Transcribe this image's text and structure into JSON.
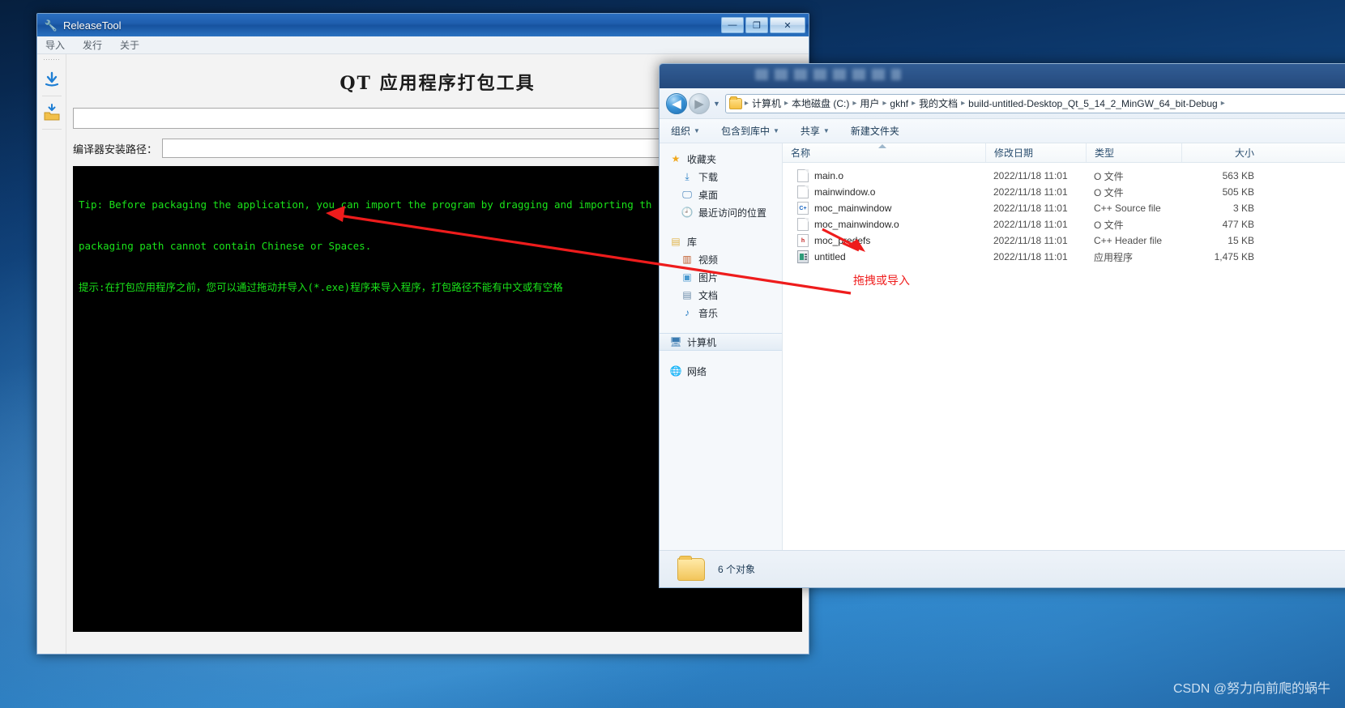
{
  "release_tool": {
    "title": "ReleaseTool",
    "title_icon": "tools-icon",
    "window_buttons": {
      "minimize": "—",
      "maximize": "❐",
      "close": "✕"
    },
    "menu": [
      {
        "label": "导入",
        "name": "menu-import"
      },
      {
        "label": "发行",
        "name": "menu-publish"
      },
      {
        "label": "关于",
        "name": "menu-about"
      }
    ],
    "toolbar": [
      {
        "name": "import-file-icon",
        "glyph": "⬇"
      },
      {
        "name": "import-folder-icon",
        "glyph": "📁"
      }
    ],
    "heading": "QT 应用程序打包工具",
    "path_input_value": "",
    "path_input_placeholder": "",
    "compiler_label": "编译器安装路径：",
    "compiler_input_value": "",
    "compiler_input_placeholder": "",
    "console_lines": [
      "Tip: Before packaging the application, you can import the program by dragging and importing th",
      "packaging path cannot contain Chinese or Spaces.",
      "提示:在打包应用程序之前，您可以通过拖动并导入(*.exe)程序来导入程序，打包路径不能有中文或有空格"
    ],
    "console_color": "#1ae31a",
    "console_background": "#000000"
  },
  "explorer": {
    "nav": {
      "back": "◀",
      "forward": "▶",
      "recent": "▼"
    },
    "breadcrumbs": [
      "计算机",
      "本地磁盘 (C:)",
      "用户",
      "gkhf",
      "我的文档",
      "build-untitled-Desktop_Qt_5_14_2_MinGW_64_bit-Debug"
    ],
    "breadcrumb_separator": "▸",
    "toolbar": [
      {
        "label": "组织",
        "name": "toolbar-organize",
        "caret": "▼"
      },
      {
        "label": "包含到库中",
        "name": "toolbar-include-in-library",
        "caret": "▼"
      },
      {
        "label": "共享",
        "name": "toolbar-share",
        "caret": "▼"
      },
      {
        "label": "新建文件夹",
        "name": "toolbar-new-folder",
        "caret": ""
      }
    ],
    "sidebar": [
      {
        "label": "收藏夹",
        "icon": "star-icon",
        "glyph": "★",
        "level": 0,
        "selected": false
      },
      {
        "label": "下载",
        "icon": "downloads-icon",
        "glyph": "⤓",
        "level": 1,
        "selected": false
      },
      {
        "label": "桌面",
        "icon": "desktop-icon",
        "glyph": "🖵",
        "level": 1,
        "selected": false
      },
      {
        "label": "最近访问的位置",
        "icon": "recent-places-icon",
        "glyph": "🕘",
        "level": 1,
        "selected": false
      },
      {
        "label": "库",
        "icon": "libraries-icon",
        "glyph": "▤",
        "level": 0,
        "selected": false
      },
      {
        "label": "视频",
        "icon": "videos-icon",
        "glyph": "▥",
        "level": 1,
        "selected": false
      },
      {
        "label": "图片",
        "icon": "pictures-icon",
        "glyph": "▣",
        "level": 1,
        "selected": false
      },
      {
        "label": "文档",
        "icon": "documents-icon",
        "glyph": "▤",
        "level": 1,
        "selected": false
      },
      {
        "label": "音乐",
        "icon": "music-icon",
        "glyph": "♪",
        "level": 1,
        "selected": false
      },
      {
        "label": "计算机",
        "icon": "computer-icon",
        "glyph": "🖥",
        "level": 0,
        "selected": true
      },
      {
        "label": "网络",
        "icon": "network-icon",
        "glyph": "🌐",
        "level": 0,
        "selected": false
      }
    ],
    "columns": [
      "名称",
      "修改日期",
      "类型",
      "大小"
    ],
    "files": [
      {
        "name": "main.o",
        "date": "2022/11/18 11:01",
        "type": "O 文件",
        "size": "563 KB",
        "icon": "o-file-icon"
      },
      {
        "name": "mainwindow.o",
        "date": "2022/11/18 11:01",
        "type": "O 文件",
        "size": "505 KB",
        "icon": "o-file-icon"
      },
      {
        "name": "moc_mainwindow",
        "date": "2022/11/18 11:01",
        "type": "C++ Source file",
        "size": "3 KB",
        "icon": "cpp-source-icon"
      },
      {
        "name": "moc_mainwindow.o",
        "date": "2022/11/18 11:01",
        "type": "O 文件",
        "size": "477 KB",
        "icon": "o-file-icon"
      },
      {
        "name": "moc_predefs",
        "date": "2022/11/18 11:01",
        "type": "C++ Header file",
        "size": "15 KB",
        "icon": "cpp-header-icon"
      },
      {
        "name": "untitled",
        "date": "2022/11/18 11:01",
        "type": "应用程序",
        "size": "1,475 KB",
        "icon": "application-icon"
      }
    ],
    "status_text": "6 个对象"
  },
  "annotation": {
    "label": "拖拽或导入",
    "color": "#ef1d1d"
  },
  "watermark": "CSDN @努力向前爬的蜗牛"
}
